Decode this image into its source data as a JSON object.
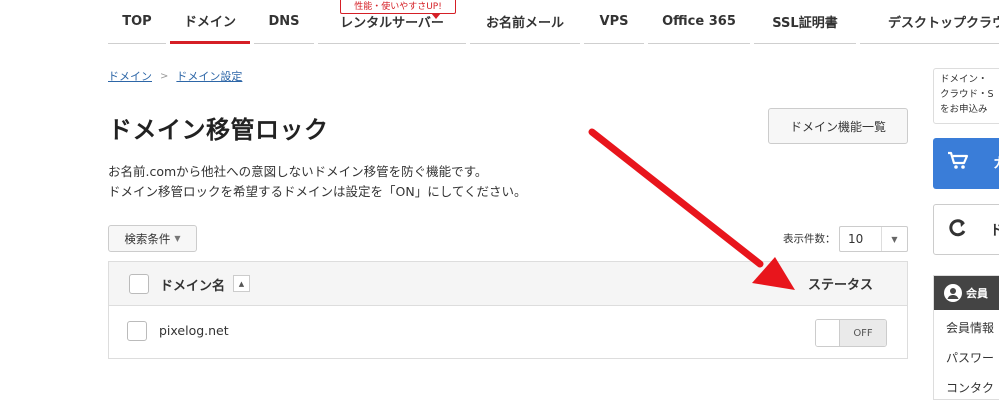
{
  "nav": {
    "badge": "性能・使いやすさUP!",
    "items": [
      {
        "label": "TOP"
      },
      {
        "label": "ドメイン"
      },
      {
        "label": "DNS"
      },
      {
        "label": "レンタルサーバー"
      },
      {
        "label": "お名前メール"
      },
      {
        "label": "VPS"
      },
      {
        "label": "Office 365"
      },
      {
        "label": "SSL証明書"
      },
      {
        "label": "デスクトップクラウ"
      }
    ]
  },
  "breadcrumb": {
    "items": [
      "ドメイン",
      "ドメイン設定"
    ],
    "separator": ">"
  },
  "page": {
    "title": "ドメイン移管ロック",
    "features_button": "ドメイン機能一覧",
    "description": [
      "お名前.comから他社への意図しないドメイン移管を防ぐ機能です。",
      "ドメイン移管ロックを希望するドメインは設定を「ON」にしてください。"
    ]
  },
  "filter": {
    "label": "検索条件"
  },
  "per_page": {
    "label": "表示件数：",
    "value": "10"
  },
  "table": {
    "headers": {
      "domain": "ドメイン名",
      "status": "ステータス"
    },
    "rows": [
      {
        "domain": "pixelog.net",
        "status": "OFF"
      }
    ]
  },
  "sidebar": {
    "info_lines": [
      "ドメイン・",
      "クラウド・S",
      "をお申込み"
    ],
    "cart_label": "カ",
    "refresh_label": "ド",
    "member": {
      "title": "会員",
      "items": [
        "会員情報",
        "パスワー",
        "コンタク"
      ]
    }
  },
  "colors": {
    "accent": "#d51f26",
    "link": "#2d66a7",
    "cart": "#3a7dd8",
    "arrow": "#e8151c"
  }
}
